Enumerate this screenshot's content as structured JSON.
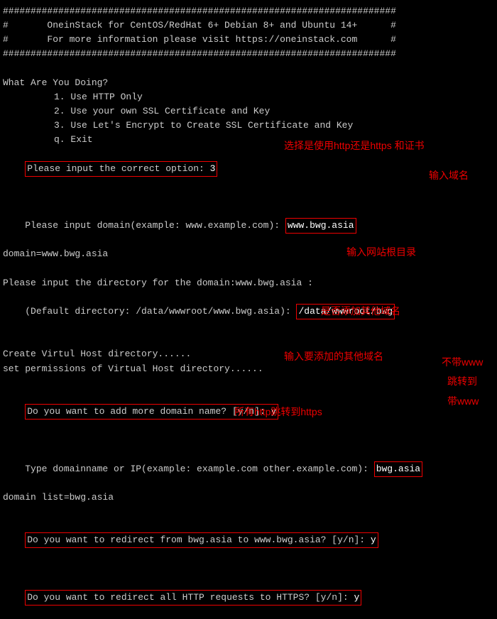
{
  "banner": {
    "border": "#######################################################################",
    "line1": "#       OneinStack for CentOS/RedHat 6+ Debian 8+ and Ubuntu 14+      #",
    "line2": "#       For more information please visit https://oneinstack.com      #"
  },
  "menu": {
    "title": "What Are You Doing?",
    "opt1": "1. Use HTTP Only",
    "opt2": "2. Use your own SSL Certificate and Key",
    "opt3": "3. Use Let's Encrypt to Create SSL Certificate and Key",
    "optq": "q. Exit"
  },
  "prompts": {
    "opt_prompt": "Please input the correct option: ",
    "opt_value": "3",
    "domain_prompt": "Please input domain(example: www.example.com): ",
    "domain_value": "www.bwg.asia",
    "domain_echo": "domain=www.bwg.asia",
    "dir_prompt1": "Please input the directory for the domain:www.bwg.asia :",
    "dir_prompt2": "(Default directory: /data/wwwroot/www.bwg.asia): ",
    "dir_value": "/data/wwwroot/bwg",
    "create_dir": "Create Virtul Host directory......",
    "set_perm": "set permissions of Virtual Host directory......",
    "more_domain_prompt": "Do you want to add more domain name? [y/n]: ",
    "more_domain_value": "y",
    "type_domain_prompt": "Type domainname or IP(example: example.com other.example.com): ",
    "type_domain_value": "bwg.asia",
    "domain_list": "domain list=bwg.asia",
    "redirect_prompt": "Do you want to redirect from bwg.asia to www.bwg.asia? [y/n]: ",
    "redirect_value": "y",
    "https_prompt": "Do you want to redirect all HTTP requests to HTTPS? [y/n]: ",
    "https_value": "y"
  },
  "annotations": {
    "a1": "选择是使用http还是https 和证书",
    "a2": "输入域名",
    "a3": "输入网站根目录",
    "a4": "是否添加其他域名",
    "a5": "输入要添加的其他域名",
    "a6a": "不带www",
    "a6b": "跳转到",
    "a6c": "带www",
    "a7": "所有http跳转到https"
  }
}
